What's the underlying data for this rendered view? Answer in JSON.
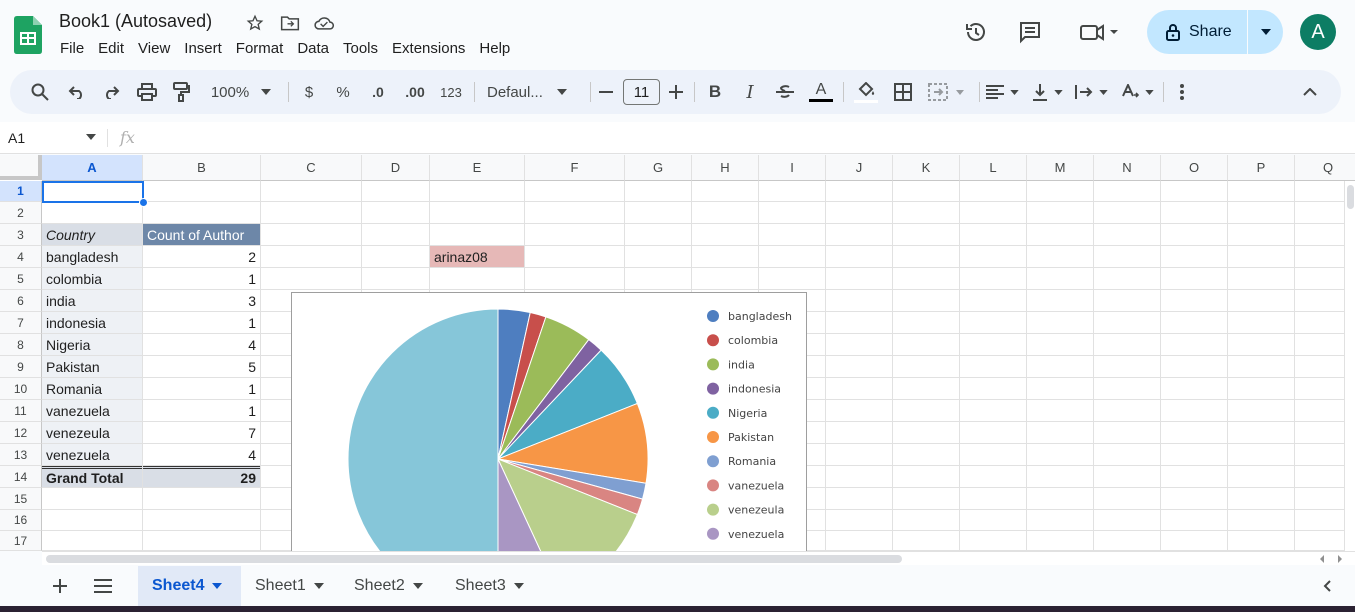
{
  "document": {
    "title": "Book1 (Autosaved)",
    "menu": [
      "File",
      "Edit",
      "View",
      "Insert",
      "Format",
      "Data",
      "Tools",
      "Extensions",
      "Help"
    ]
  },
  "header": {
    "share_label": "Share",
    "avatar_letter": "A"
  },
  "toolbar": {
    "zoom": "100%",
    "currency": "$",
    "percent": "%",
    "decimal_decrease": ".0",
    "decimal_increase": ".00",
    "number_format": "123",
    "font": "Defaul...",
    "font_size": "11",
    "bold": "B",
    "italic": "I",
    "text_color": "A"
  },
  "formula_bar": {
    "name_box": "A1",
    "fx": "fx"
  },
  "grid": {
    "columns": [
      "A",
      "B",
      "C",
      "D",
      "E",
      "F",
      "G",
      "H",
      "I",
      "J",
      "K",
      "L",
      "M",
      "N",
      "O",
      "P",
      "Q"
    ],
    "rows": [
      "1",
      "2",
      "3",
      "4",
      "5",
      "6",
      "7",
      "8",
      "9",
      "10",
      "11",
      "12",
      "13",
      "14",
      "15",
      "16",
      "17"
    ],
    "pivot_header": {
      "country": "Country",
      "count": "Count of Author"
    },
    "pivot_rows": [
      {
        "country": "bangladesh",
        "count": "2"
      },
      {
        "country": "colombia",
        "count": "1"
      },
      {
        "country": "india",
        "count": "3"
      },
      {
        "country": "indonesia",
        "count": "1"
      },
      {
        "country": "Nigeria",
        "count": "4"
      },
      {
        "country": "Pakistan",
        "count": "5"
      },
      {
        "country": "Romania",
        "count": "1"
      },
      {
        "country": "vanezuela",
        "count": "1"
      },
      {
        "country": "venezeula",
        "count": "7"
      },
      {
        "country": "venezuela",
        "count": "4"
      }
    ],
    "grand_total": {
      "label": "Grand Total",
      "value": "29"
    },
    "e4_value": "arinaz08"
  },
  "chart_data": {
    "type": "pie",
    "categories": [
      "bangladesh",
      "colombia",
      "india",
      "indonesia",
      "Nigeria",
      "Pakistan",
      "Romania",
      "vanezuela",
      "venezeula",
      "venezuela"
    ],
    "values": [
      2,
      1,
      3,
      1,
      4,
      5,
      1,
      1,
      7,
      4
    ],
    "legend_position": "right",
    "colors": [
      "#4e7ec0",
      "#c84f4b",
      "#9bbb59",
      "#7f62a1",
      "#4bacc6",
      "#f79646",
      "#7f9fd1",
      "#d98582",
      "#b9cf8c",
      "#a996c3"
    ],
    "visible_other_color": "#86c6d9"
  },
  "sheet_tabs": [
    {
      "label": "Sheet4",
      "active": true
    },
    {
      "label": "Sheet1",
      "active": false
    },
    {
      "label": "Sheet2",
      "active": false
    },
    {
      "label": "Sheet3",
      "active": false
    }
  ],
  "colors": {
    "accent": "#0b57d0",
    "share_bg": "#c2e7ff",
    "avatar_bg": "#0d7d64",
    "pivot_header_bg": "#6d87a8",
    "pivot_country_bg": "#d9dee6",
    "e4_bg": "#e6b8b7"
  }
}
